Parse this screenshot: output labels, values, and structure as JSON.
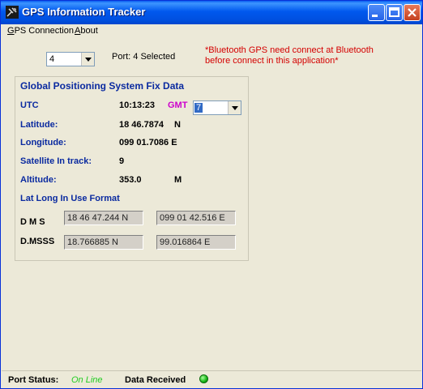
{
  "window": {
    "title": "GPS Information Tracker"
  },
  "menu": {
    "items": [
      {
        "label": "GPS Connection",
        "mnemonic": "G",
        "rest": "PS Connection"
      },
      {
        "label": "About",
        "mnemonic": "A",
        "rest": "bout"
      }
    ]
  },
  "port": {
    "selected_value": "4",
    "status_text": "Port: 4 Selected"
  },
  "notice": "*Bluetooth GPS need connect at Bluetooth before connect in this application*",
  "fix": {
    "group_title": "Global Positioning System Fix Data",
    "utc_label": "UTC",
    "utc_value": "10:13:23",
    "gmt_label": "GMT",
    "gmt_value": "7",
    "lat_label": "Latitude:",
    "lat_value": "18 46.7874",
    "lat_hemi": "N",
    "lon_label": "Longitude:",
    "lon_value": "099 01.7086 E",
    "sat_label": "Satellite In track:",
    "sat_value": "9",
    "alt_label": "Altitude:",
    "alt_value": "353.0",
    "alt_unit": "M",
    "format_label": "Lat Long In Use Format",
    "dms_label": "D M S",
    "dms_lat": "18 46 47.244 N",
    "dms_lon": "099 01 42.516 E",
    "dmsss_label": "D.MSSS",
    "dmsss_lat": "18.766885 N",
    "dmsss_lon": "99.016864 E"
  },
  "status": {
    "port_label": "Port Status:",
    "port_value": "On Line",
    "data_label": "Data Received"
  },
  "colors": {
    "titlebar": "#0058ee",
    "label_blue": "#0a2aa0",
    "warning_red": "#d40000",
    "gmt_magenta": "#cc00cc",
    "online_green": "#22cc22",
    "led_green": "#16b416"
  }
}
